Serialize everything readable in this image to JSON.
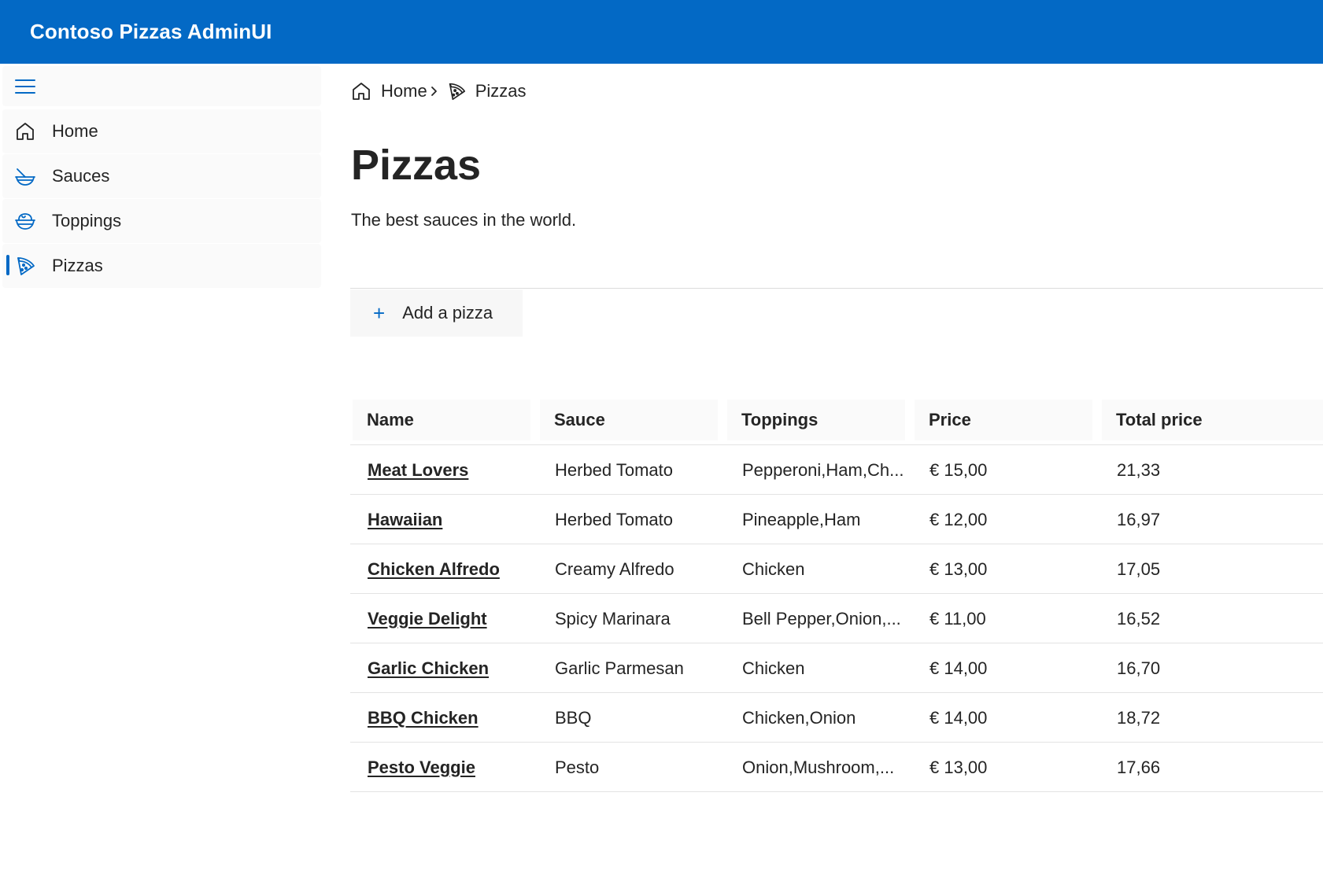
{
  "app": {
    "title": "Contoso Pizzas AdminUI"
  },
  "sidebar": {
    "menu_icon": "hamburger-icon",
    "items": [
      {
        "label": "Home",
        "icon": "home-icon",
        "active": false
      },
      {
        "label": "Sauces",
        "icon": "bowl-icon",
        "active": false
      },
      {
        "label": "Toppings",
        "icon": "salad-icon",
        "active": false
      },
      {
        "label": "Pizzas",
        "icon": "pizza-icon",
        "active": true
      }
    ]
  },
  "breadcrumb": [
    {
      "label": "Home",
      "icon": "home-icon"
    },
    {
      "label": "Pizzas",
      "icon": "pizza-icon"
    }
  ],
  "page": {
    "title": "Pizzas",
    "description": "The best sauces in the world."
  },
  "toolbar": {
    "add_label": "Add a pizza",
    "add_icon": "plus-icon"
  },
  "table": {
    "columns": [
      "Name",
      "Sauce",
      "Toppings",
      "Price",
      "Total price"
    ],
    "rows": [
      {
        "name": "Meat Lovers",
        "sauce": "Herbed Tomato",
        "toppings": "Pepperoni,Ham,Ch...",
        "price": "€ 15,00",
        "total": "21,33"
      },
      {
        "name": "Hawaiian",
        "sauce": "Herbed Tomato",
        "toppings": "Pineapple,Ham",
        "price": "€ 12,00",
        "total": "16,97"
      },
      {
        "name": "Chicken Alfredo",
        "sauce": "Creamy Alfredo",
        "toppings": "Chicken",
        "price": "€ 13,00",
        "total": "17,05"
      },
      {
        "name": "Veggie Delight",
        "sauce": "Spicy Marinara",
        "toppings": "Bell Pepper,Onion,...",
        "price": "€ 11,00",
        "total": "16,52"
      },
      {
        "name": "Garlic Chicken",
        "sauce": "Garlic Parmesan",
        "toppings": "Chicken",
        "price": "€ 14,00",
        "total": "16,70"
      },
      {
        "name": "BBQ Chicken",
        "sauce": "BBQ",
        "toppings": "Chicken,Onion",
        "price": "€ 14,00",
        "total": "18,72"
      },
      {
        "name": "Pesto Veggie",
        "sauce": "Pesto",
        "toppings": "Onion,Mushroom,...",
        "price": "€ 13,00",
        "total": "17,66"
      }
    ]
  },
  "colors": {
    "brand": "#0369c5",
    "text": "#242424",
    "nav_bg": "#fafafa",
    "divider": "#e3e3e3"
  }
}
